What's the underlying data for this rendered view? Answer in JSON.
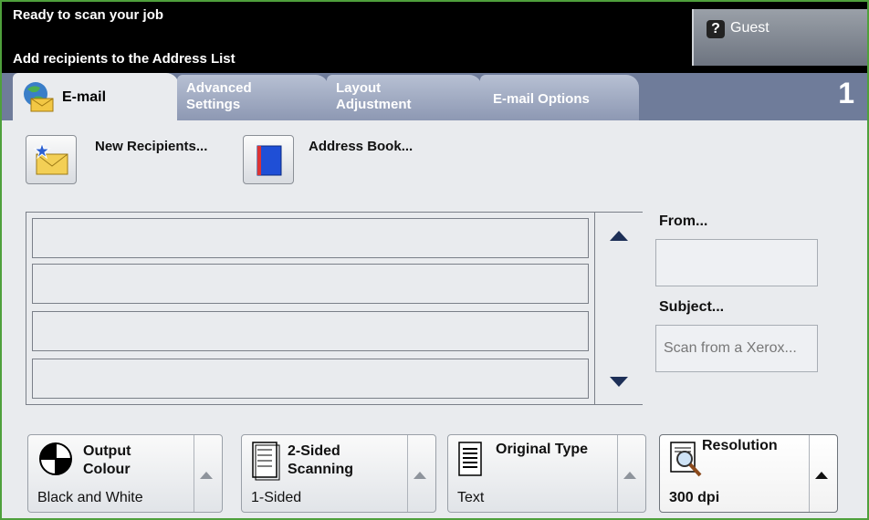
{
  "header": {
    "status": "Ready to scan your job",
    "instruction": "Add recipients to the Address List",
    "user_label": "Guest"
  },
  "tabs": [
    {
      "label": "E-mail"
    },
    {
      "label": "Advanced Settings"
    },
    {
      "label": "Layout Adjustment"
    },
    {
      "label": "E-mail Options"
    }
  ],
  "copy_count": "1",
  "recipients": {
    "new_label": "New Recipients...",
    "address_book_label": "Address Book..."
  },
  "fields": {
    "from_label": "From...",
    "from_value": "",
    "subject_label": "Subject...",
    "subject_value": "Scan from a Xerox..."
  },
  "features": [
    {
      "title": "Output Colour",
      "value": "Black and White"
    },
    {
      "title": "2-Sided Scanning",
      "value": "1-Sided"
    },
    {
      "title": "Original Type",
      "value": "Text"
    },
    {
      "title": "Resolution",
      "value": "300 dpi"
    }
  ],
  "icons": {
    "guest": "help-icon",
    "email_tab": "globe-envelope-icon",
    "new_recipients": "star-envelope-icon",
    "address_book": "book-icon",
    "output_colour": "colour-wheel-icon",
    "two_sided": "document-icon",
    "original_type": "text-document-icon",
    "resolution": "magnifier-document-icon"
  }
}
